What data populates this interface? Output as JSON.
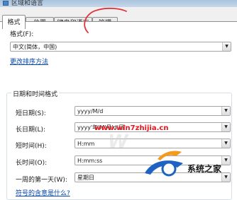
{
  "window": {
    "title": "区域和语言"
  },
  "tabs": [
    {
      "label": "格式"
    },
    {
      "label": "位置"
    },
    {
      "label": "键盘和语言"
    },
    {
      "label": "管理"
    }
  ],
  "format": {
    "label": "格式(F):",
    "value": "中文(简体，中国)",
    "sort_link": "更改排序方法"
  },
  "datetime": {
    "group_title": "日期和时间格式",
    "fields": [
      {
        "label": "短日期(S):",
        "value": "yyyy/M/d"
      },
      {
        "label": "长日期(L):",
        "value": "yyyy'年'M'月'd'日'"
      },
      {
        "label": "短时间(H):",
        "value": "H:mm"
      },
      {
        "label": "长时间(O):",
        "value": "H:mm:ss"
      },
      {
        "label": "一周的第一天(W):",
        "value": "星期日"
      }
    ],
    "symbols_link": "符号的含意是什么?"
  },
  "annotation": {
    "color": "#e3313b"
  },
  "watermark": {
    "url": "www.win7zhijia.cn",
    "text": "系统之家",
    "colors": {
      "url": "#e8141d",
      "logo_blue": "#1f63c2",
      "logo_orange": "#f39a1f"
    }
  }
}
